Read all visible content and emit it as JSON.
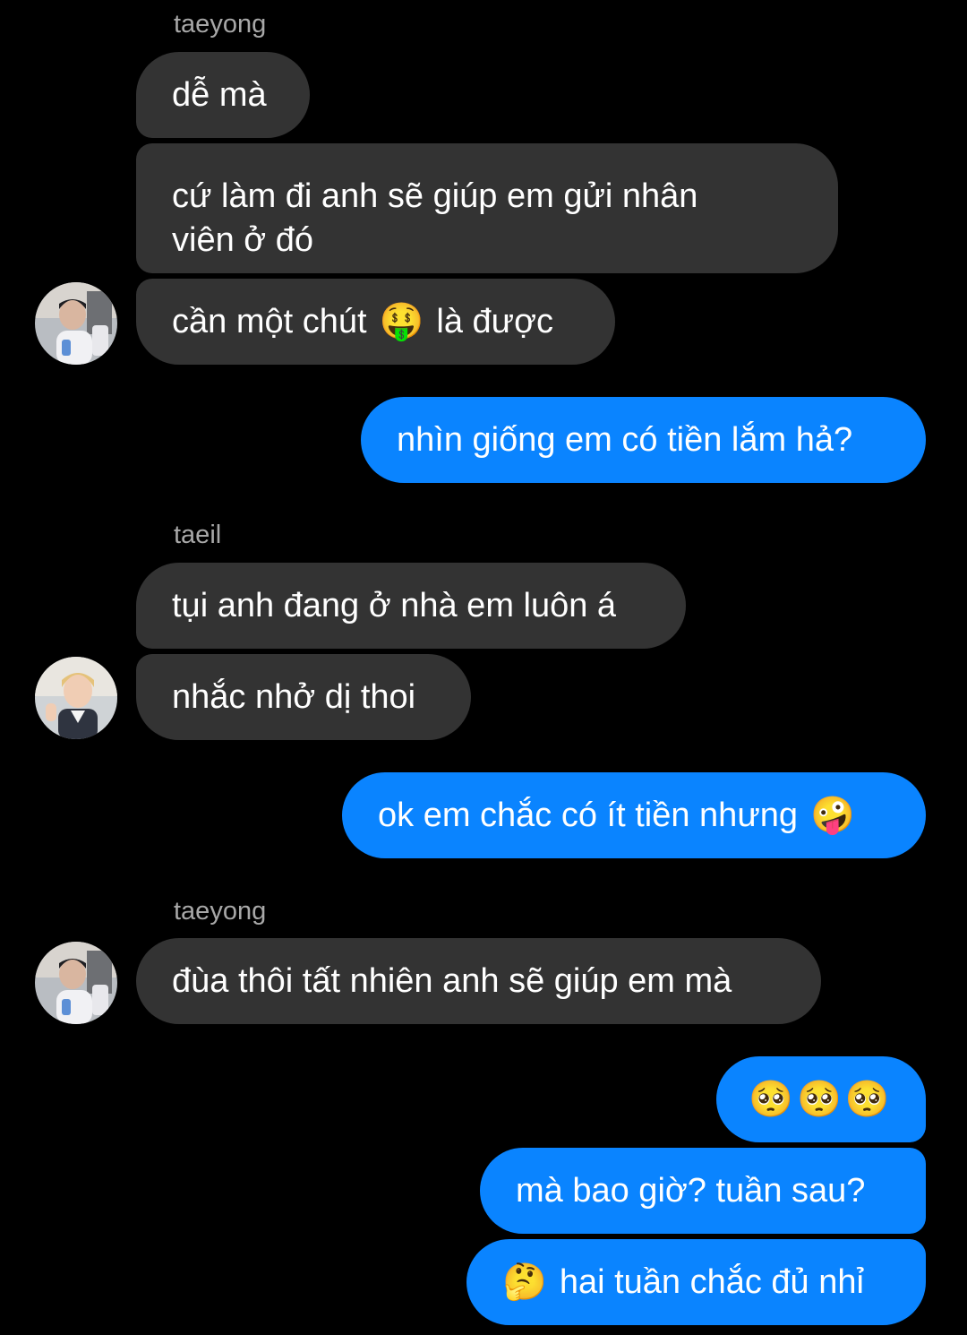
{
  "conversation": {
    "messages": [
      {
        "sender": "taeyong",
        "text": "dễ mà"
      },
      {
        "sender": "taeyong",
        "text": "cứ làm đi anh sẽ giúp em gửi nhân viên ở đó"
      },
      {
        "sender": "taeyong",
        "text_before": "cần một chút",
        "emoji": "🤑",
        "text_after": "là được"
      },
      {
        "sender": "me",
        "text": "nhìn giống em có tiền lắm hả?"
      },
      {
        "sender": "taeil",
        "text": "tụi anh đang ở nhà em luôn á"
      },
      {
        "sender": "taeil",
        "text": "nhắc nhở dị thoi"
      },
      {
        "sender": "me",
        "text": "ok em chắc có ít tiền nhưng",
        "emoji": "🤪"
      },
      {
        "sender": "taeyong",
        "text": "đùa thôi tất nhiên anh sẽ giúp em mà"
      },
      {
        "sender": "me",
        "emoji": "🥺🥺🥺"
      },
      {
        "sender": "me",
        "text": "mà bao giờ? tuần sau?"
      },
      {
        "sender": "me",
        "emoji": "🤔",
        "text": "hai tuần chắc đủ nhỉ"
      }
    ]
  },
  "senders": {
    "taeyong": "taeyong",
    "taeil": "taeil"
  },
  "theme": {
    "background": "#000000",
    "incoming_bubble": "#333333",
    "outgoing_bubble": "#0a84ff",
    "sender_name": "#a8a8a8",
    "text": "#ffffff"
  }
}
